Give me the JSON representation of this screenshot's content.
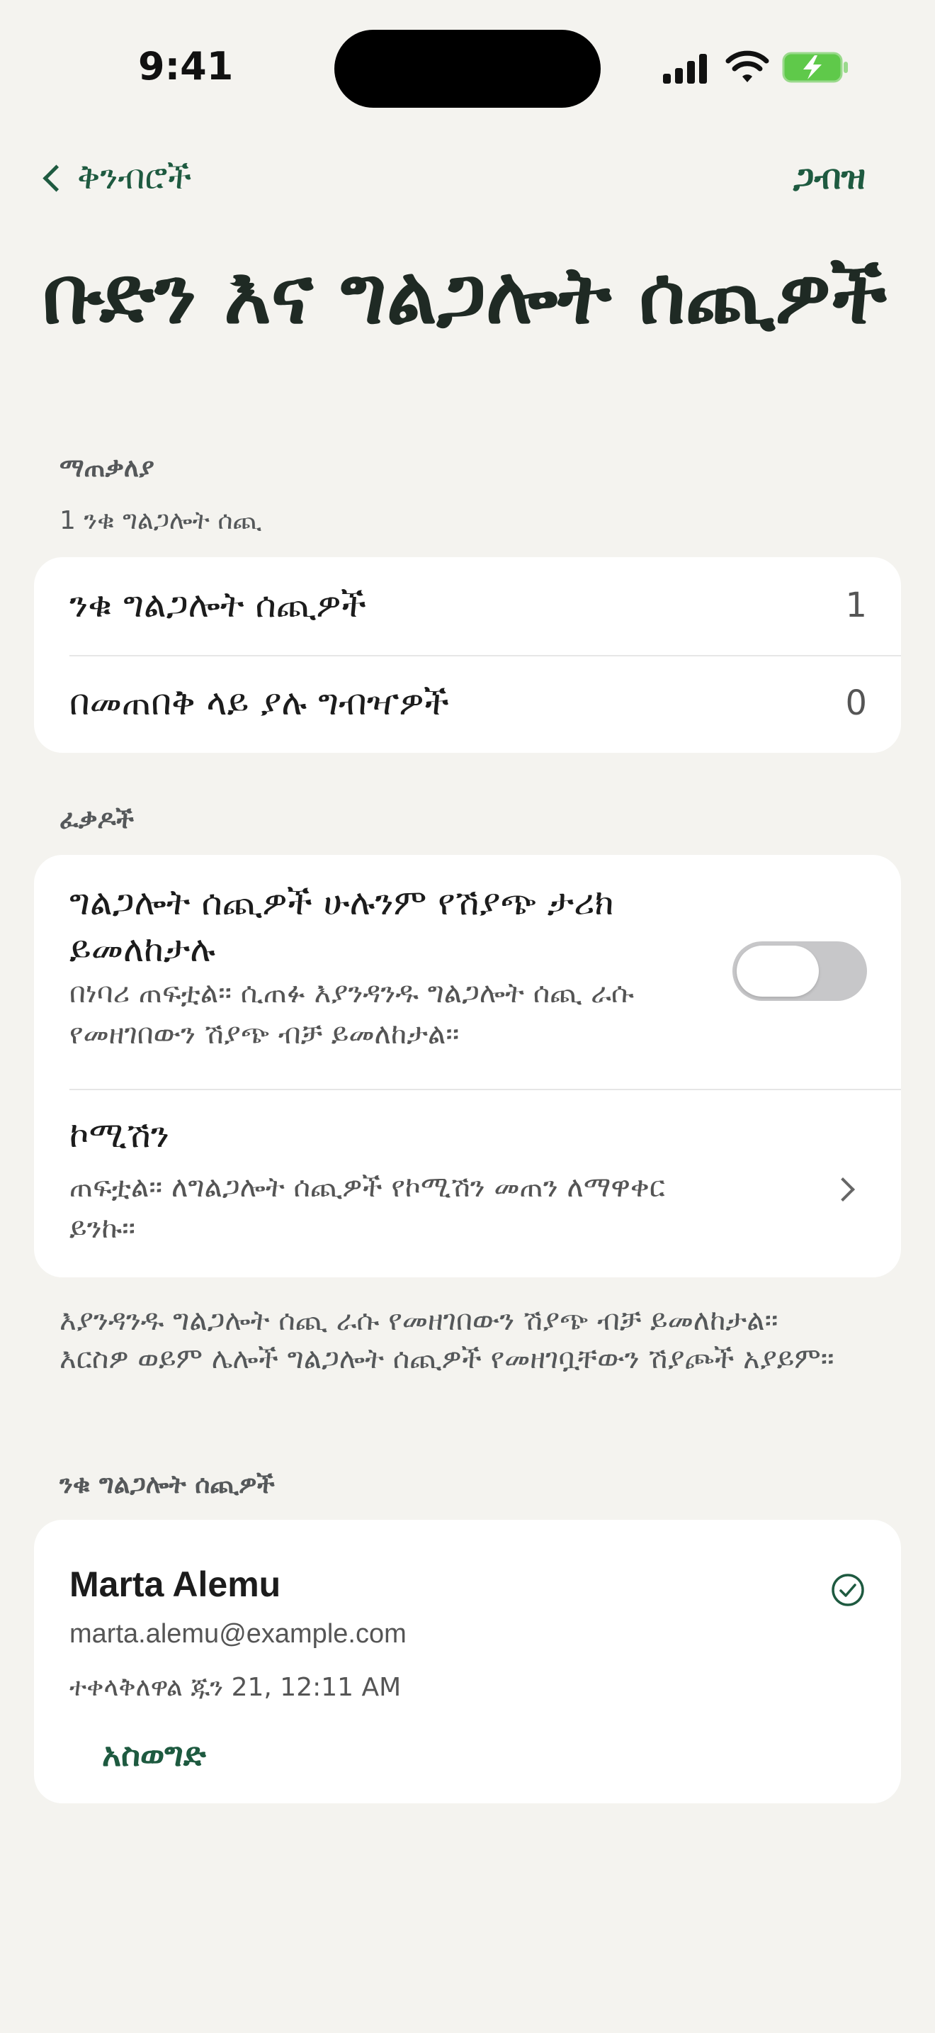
{
  "status_bar": {
    "time": "9:41"
  },
  "nav": {
    "back_label": "ቅንብሮች",
    "done_label": "ጋብዝ"
  },
  "title": "ቡድን እና ግልጋሎት ሰጪዎች",
  "summary": {
    "header": "ማጠቃለያ",
    "subtitle": "1 ንቁ ግልጋሎት ሰጪ",
    "rows": [
      {
        "label": "ንቁ ግልጋሎት ሰጪዎች",
        "value": "1"
      },
      {
        "label": "በመጠበቅ ላይ ያሉ ግብዣዎች",
        "value": "0"
      }
    ]
  },
  "permissions": {
    "header": "ፈቃዶች",
    "show_all": {
      "title": "ግልጋሎት ሰጪዎች ሁሉንም የሽያጭ ታሪክ ይመለከታሉ",
      "description": "በነባሪ ጠፍቷል፡፡ ሲጠፉ እያንዳንዱ ግልጋሎት ሰጪ ራሱ የመዘገበውን ሽያጭ ብቻ ይመለከታል፡፡",
      "enabled": false
    },
    "commission": {
      "title": "ኮሚሽን",
      "description": "ጠፍቷል፡፡ ለግልጋሎት ሰጪዎች የኮሚሽን መጠን ለማዋቀር ይንኩ፡፡"
    },
    "footer_note": "እያንዳንዱ ግልጋሎት ሰጪ ራሱ የመዘገበውን ሽያጭ ብቻ ይመለከታል፡፡ እርስዎ ወይም ሌሎች ግልጋሎት ሰጪዎች የመዘገቧቸውን ሽያጮች አያይም፡፡"
  },
  "active_staff": {
    "header": "ንቁ ግልጋሎት ሰጪዎች",
    "members": [
      {
        "name": "Marta Alemu",
        "email": "marta.alemu@example.com",
        "joined": "ተቀላቅለዋል ጁን 21, 12:11 AM",
        "remove_label": "አስወግድ"
      }
    ]
  },
  "colors": {
    "accent": "#1e5a40",
    "background": "#f4f3ef",
    "card": "#ffffff",
    "toggle_off": "#c7c7c9",
    "battery": "#5fc94a"
  },
  "icons": [
    "signal-icon",
    "wifi-icon",
    "battery-charging-icon",
    "chevron-left-icon",
    "chevron-right-icon",
    "check-circle-icon"
  ]
}
